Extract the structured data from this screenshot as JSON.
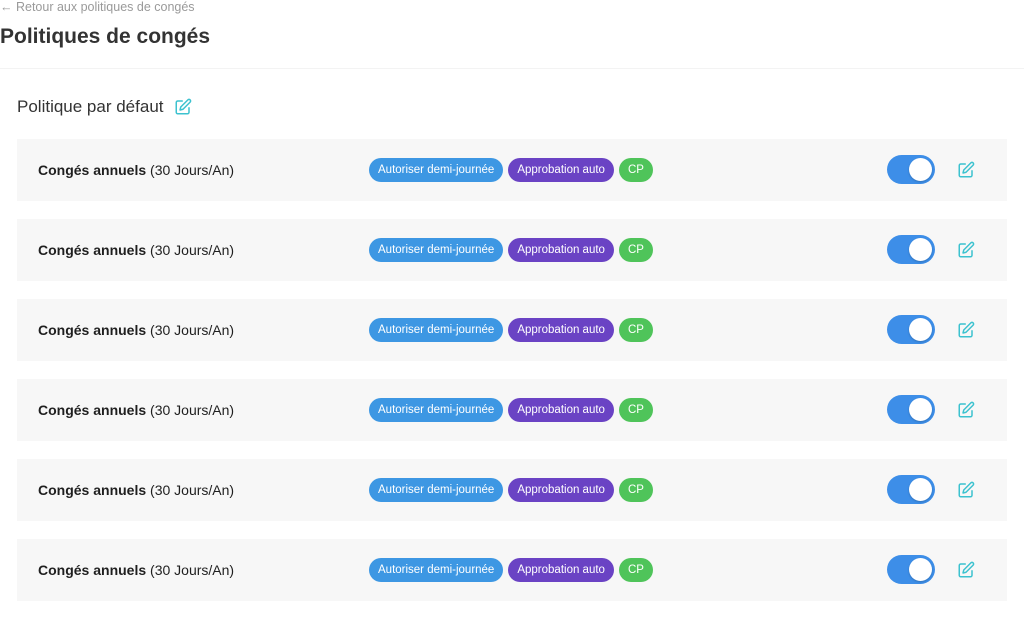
{
  "header": {
    "back_link": "← Retour aux politiques de congés",
    "title": "Politiques de congés"
  },
  "section": {
    "title": "Politique par défaut",
    "edit_icon": "edit-icon"
  },
  "colors": {
    "accent_teal": "#3cc2cf",
    "toggle_on": "#3d8ee8",
    "badge_blue": "#3d97e3",
    "badge_purple": "#6a43c4",
    "badge_green": "#4fc45a",
    "row_bg": "#f7f7f7"
  },
  "policies": [
    {
      "name": "Congés annuels",
      "detail": "(30 Jours/An)",
      "badges": [
        "Autoriser demi-journée",
        "Approbation auto",
        "CP"
      ],
      "enabled": true
    },
    {
      "name": "Congés annuels",
      "detail": "(30 Jours/An)",
      "badges": [
        "Autoriser demi-journée",
        "Approbation auto",
        "CP"
      ],
      "enabled": true
    },
    {
      "name": "Congés annuels",
      "detail": "(30 Jours/An)",
      "badges": [
        "Autoriser demi-journée",
        "Approbation auto",
        "CP"
      ],
      "enabled": true
    },
    {
      "name": "Congés annuels",
      "detail": "(30 Jours/An)",
      "badges": [
        "Autoriser demi-journée",
        "Approbation auto",
        "CP"
      ],
      "enabled": true
    },
    {
      "name": "Congés annuels",
      "detail": "(30 Jours/An)",
      "badges": [
        "Autoriser demi-journée",
        "Approbation auto",
        "CP"
      ],
      "enabled": true
    },
    {
      "name": "Congés annuels",
      "detail": "(30 Jours/An)",
      "badges": [
        "Autoriser demi-journée",
        "Approbation auto",
        "CP"
      ],
      "enabled": true
    }
  ]
}
